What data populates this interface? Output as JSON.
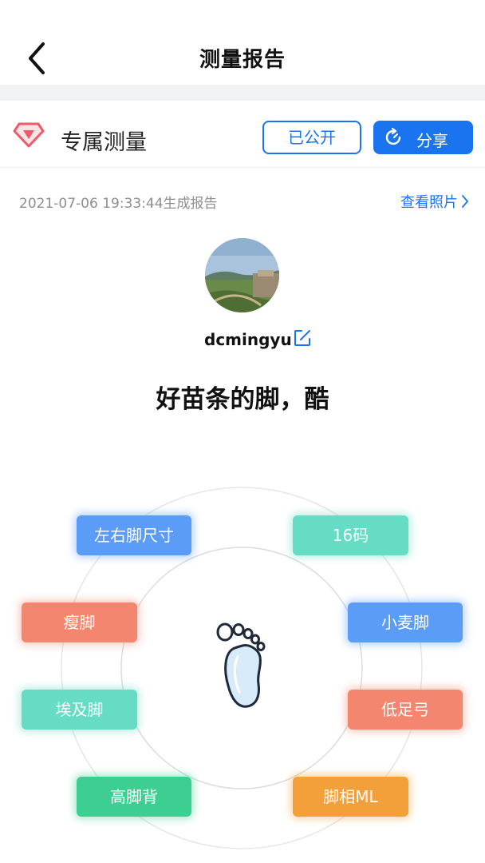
{
  "header": {
    "title": "测量报告"
  },
  "section": {
    "title": "专属测量",
    "public_label": "已公开",
    "share_label": "分享"
  },
  "report": {
    "time": "2021-07-06 19:33:44生成报告",
    "view_photo_label": "查看照片"
  },
  "profile": {
    "username": "dcmingyu",
    "verdict": "好苗条的脚，酷"
  },
  "tags": [
    {
      "label": "左右脚尺寸",
      "color": "blue"
    },
    {
      "label": "16码",
      "color": "teal"
    },
    {
      "label": "瘦脚",
      "color": "salmon"
    },
    {
      "label": "小麦脚",
      "color": "blue"
    },
    {
      "label": "埃及脚",
      "color": "teal"
    },
    {
      "label": "低足弓",
      "color": "salmon"
    },
    {
      "label": "高脚背",
      "color": "green"
    },
    {
      "label": "脚相ML",
      "color": "orange"
    }
  ],
  "colors": {
    "accent": "#1a74f0",
    "blue": "#5a9cf8",
    "teal": "#66dcc4",
    "salmon": "#f4856e",
    "green": "#3dcf92",
    "orange": "#f4a03a"
  }
}
